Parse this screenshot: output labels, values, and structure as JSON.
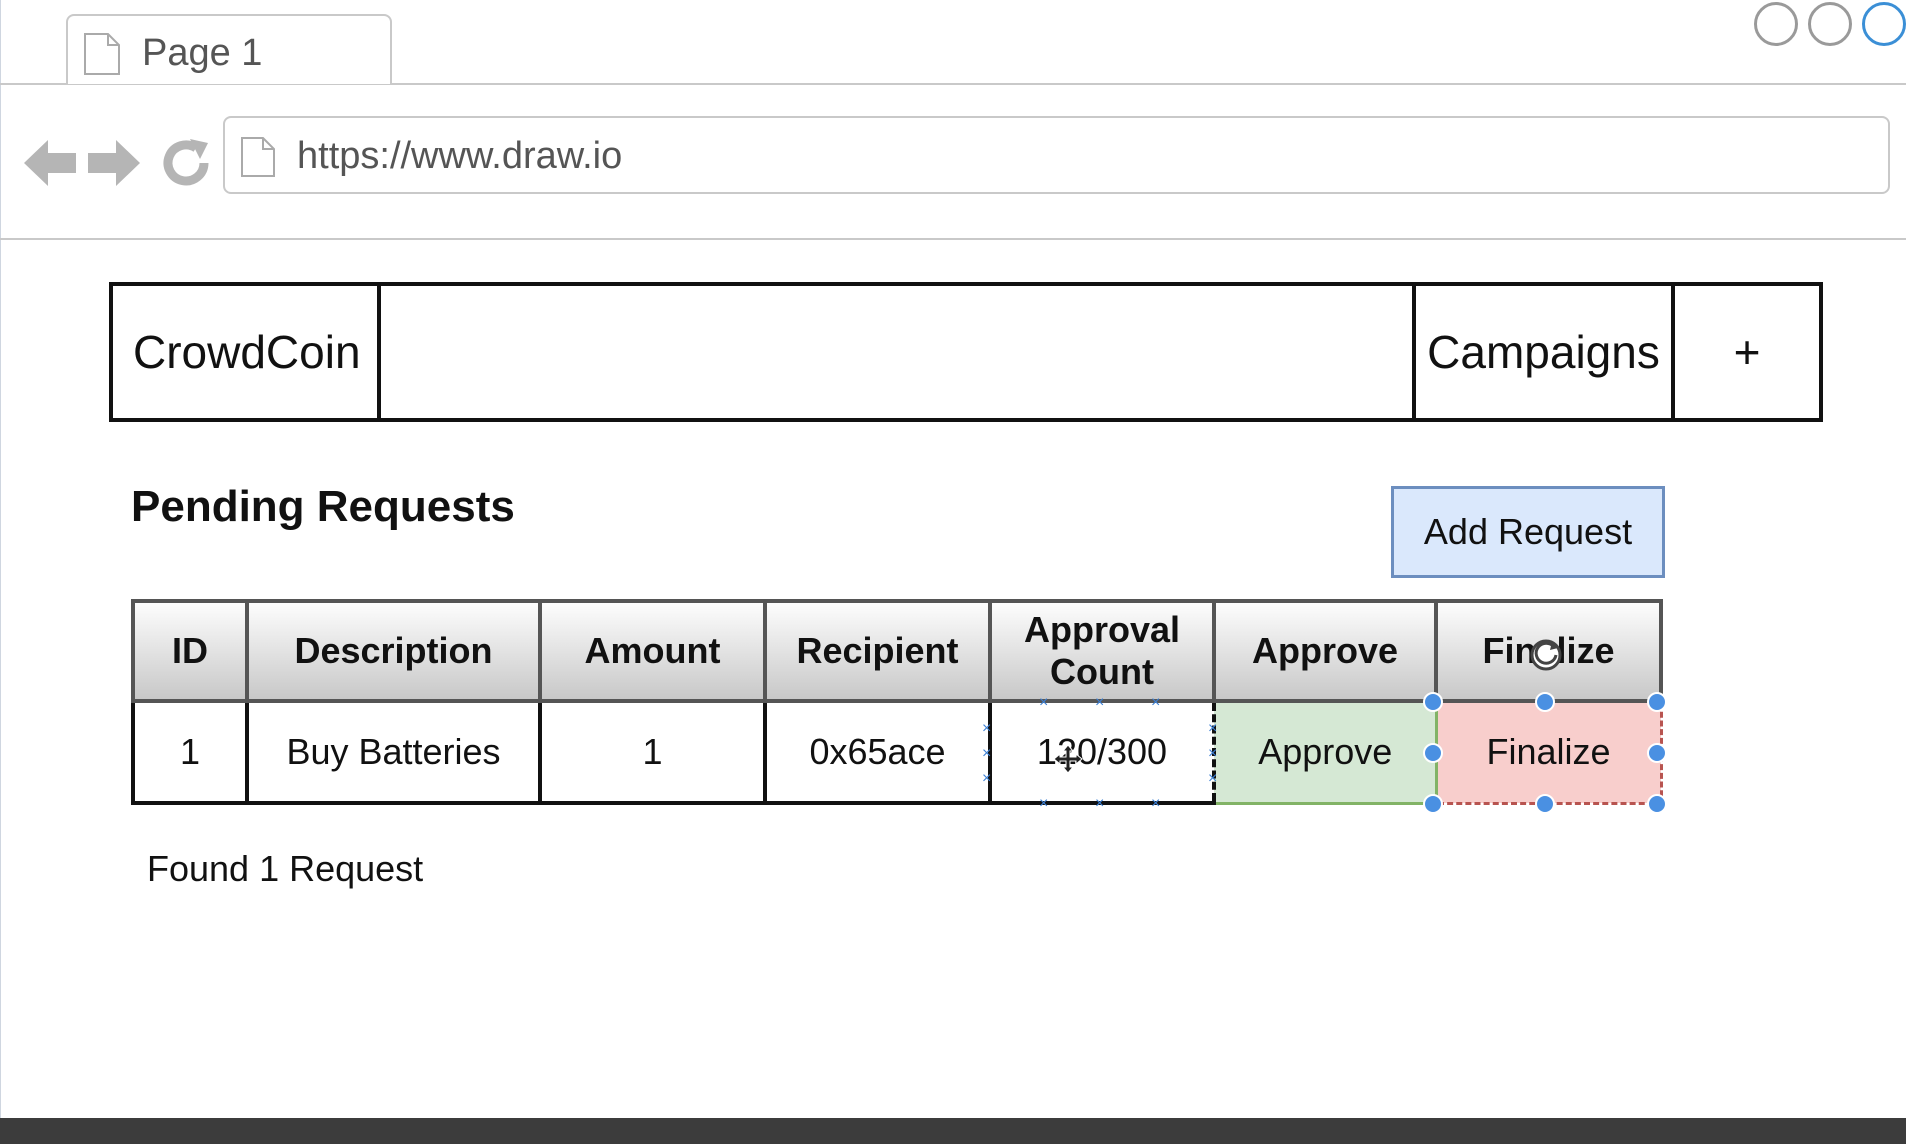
{
  "browser": {
    "tab_title": "Page 1",
    "url": "https://www.draw.io"
  },
  "navbar": {
    "brand": "CrowdCoin",
    "campaigns": "Campaigns",
    "plus": "+"
  },
  "page": {
    "title": "Pending Requests",
    "add_request_label": "Add Request",
    "footer": "Found 1 Request"
  },
  "table": {
    "headers": {
      "id": "ID",
      "description": "Description",
      "amount": "Amount",
      "recipient": "Recipient",
      "approval_line1": "Approval",
      "approval_line2": "Count",
      "approve": "Approve",
      "finalize": "Finalize"
    },
    "rows": [
      {
        "id": "1",
        "description": "Buy Batteries",
        "amount": "1",
        "recipient": "0x65ace",
        "approval_count": "120/300",
        "approve_label": "Approve",
        "finalize_label": "Finalize"
      }
    ]
  },
  "colors": {
    "approve_fill": "#d5e8d4",
    "finalize_fill": "#f8cecc",
    "add_request_fill": "#dae8fc",
    "selection_handle": "#4a90e2"
  }
}
